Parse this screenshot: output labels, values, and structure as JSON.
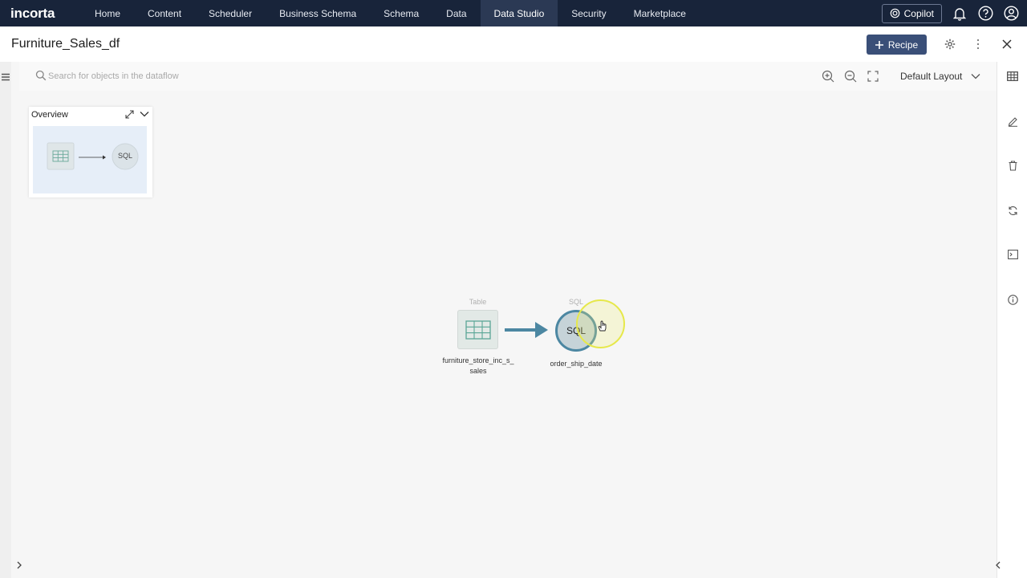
{
  "app": {
    "logo": "incorta"
  },
  "nav": {
    "items": [
      {
        "label": "Home"
      },
      {
        "label": "Content"
      },
      {
        "label": "Scheduler"
      },
      {
        "label": "Business Schema"
      },
      {
        "label": "Schema"
      },
      {
        "label": "Data"
      },
      {
        "label": "Data Studio",
        "active": true
      },
      {
        "label": "Security"
      },
      {
        "label": "Marketplace"
      }
    ],
    "copilot_label": "Copilot"
  },
  "header": {
    "title": "Furniture_Sales_df",
    "recipe_label": "Recipe"
  },
  "toolbar": {
    "search_placeholder": "Search for objects in the dataflow",
    "layout_value": "Default Layout"
  },
  "overview": {
    "title": "Overview",
    "sql_text": "SQL"
  },
  "nodes": {
    "table": {
      "type": "Table",
      "label": "furniture_store_inc_s_\nsales"
    },
    "sql": {
      "type": "SQL",
      "text": "SQL",
      "label": "order_ship_date"
    }
  },
  "colors": {
    "nav_bg": "#18243a",
    "accent": "#3a4f78",
    "sql_ring": "#4c87a2"
  }
}
